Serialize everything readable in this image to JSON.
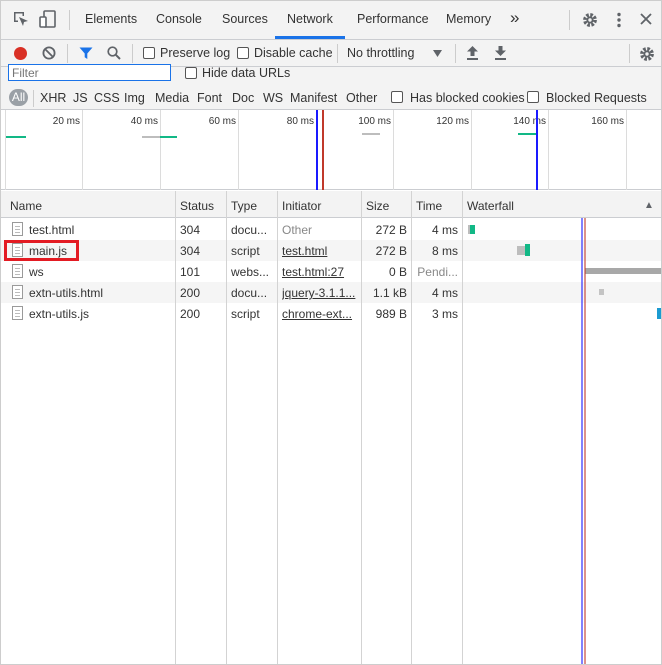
{
  "tabs": {
    "items": [
      "Elements",
      "Console",
      "Sources",
      "Network",
      "Performance",
      "Memory"
    ],
    "active": "Network",
    "more": "»"
  },
  "toolbar": {
    "preserve_log": "Preserve log",
    "disable_cache": "Disable cache",
    "throttling": "No throttling"
  },
  "filter": {
    "placeholder": "Filter",
    "value": "",
    "hide_data_urls": "Hide data URLs"
  },
  "types": {
    "all": "All",
    "items": [
      "XHR",
      "JS",
      "CSS",
      "Img",
      "Media",
      "Font",
      "Doc",
      "WS",
      "Manifest",
      "Other"
    ],
    "has_blocked_cookies": "Has blocked cookies",
    "blocked_requests": "Blocked Requests"
  },
  "overview": {
    "ticks": [
      "20 ms",
      "40 ms",
      "60 ms",
      "80 ms",
      "100 ms",
      "120 ms",
      "140 ms",
      "160 ms"
    ]
  },
  "table": {
    "headers": {
      "name": "Name",
      "status": "Status",
      "type": "Type",
      "initiator": "Initiator",
      "size": "Size",
      "time": "Time",
      "waterfall": "Waterfall",
      "sort_indicator": "▲"
    },
    "rows": [
      {
        "name": "test.html",
        "status": "304",
        "type": "docu...",
        "initiator": "Other",
        "size": "272 B",
        "time": "4 ms"
      },
      {
        "name": "main.js",
        "status": "304",
        "type": "script",
        "initiator": "test.html",
        "size": "272 B",
        "time": "8 ms"
      },
      {
        "name": "ws",
        "status": "101",
        "type": "webs...",
        "initiator": "test.html:27",
        "size": "0 B",
        "time": "Pendi..."
      },
      {
        "name": "extn-utils.html",
        "status": "200",
        "type": "docu...",
        "initiator": "jquery-3.1.1...",
        "size": "1.1 kB",
        "time": "4 ms"
      },
      {
        "name": "extn-utils.js",
        "status": "200",
        "type": "script",
        "initiator": "chrome-ext...",
        "size": "989 B",
        "time": "3 ms"
      }
    ]
  },
  "colors": {
    "accent": "#1a73e8",
    "record": "#d93025",
    "highlight": "#e31b23",
    "waterfall_green": "#12b886",
    "dom_content_loaded": "#1a1aff",
    "load_event": "#c0392b"
  }
}
